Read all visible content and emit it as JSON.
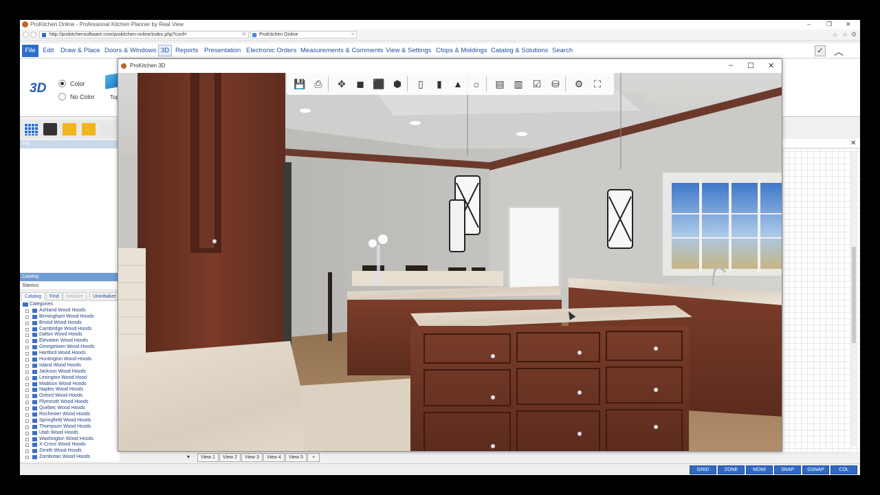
{
  "browser": {
    "title": "ProKitchen Online  -  Professional Kitchen Planner by Real View",
    "url": "http://prokitchensoftware.com/prokitchen-online/index.php?conf=",
    "tab_title": "ProKitchen Online"
  },
  "menu": {
    "file": "File",
    "items": [
      "Edit",
      "Draw & Place",
      "Doors & Windows",
      "3D",
      "Reports",
      "Presentation",
      "Electronic Orders",
      "Measurements & Comments",
      "View & Settings",
      "Ctops & Moldings",
      "Catalog & Solutions",
      "Search"
    ]
  },
  "ribbon": {
    "logo": "3D",
    "color_label": "Color",
    "nocolor_label": "No Color",
    "top_view_label": "Top View",
    "color_selected": true
  },
  "info_panel": {
    "title": "Info"
  },
  "catalog": {
    "title": "Catalog",
    "subtitle": "Stanisci",
    "tabs": [
      "Catalog",
      "Find",
      "Initialize",
      "Uninitialize"
    ],
    "root": "Categories",
    "items": [
      "Ashland Wood Hoods",
      "Birmingham Wood Hoods",
      "Bristol Wood Hoods",
      "Cambridge Wood Hoods",
      "Dalton Wood Hoods",
      "Elevation Wood Hoods",
      "Georgetown Wood Hoods",
      "Hartford Wood Hoods",
      "Huntington Wood Hoods",
      "Island Wood Hoods",
      "Jackson Wood Hoods",
      "Lexington Wood Hood",
      "Madison Wood Hoods",
      "Naples Wood Hoods",
      "Oxford Wood Hoods",
      "Plymouth Wood Hoods",
      "Quebec Wood Hoods",
      "Rochester Wood Hoods",
      "Springfield Wood Hoods",
      "Thompson Wood Hoods",
      "Utah Wood Hoods",
      "Washington Wood Hoods",
      "X-Cross Wood Hoods",
      "Zenith Wood Hoods",
      "Zombrean Wood Hoods"
    ]
  },
  "window3d": {
    "title": "ProKitchen 3D",
    "toolbar_icons": [
      "save-icon",
      "print-icon",
      "move-icon",
      "cube-solid-icon",
      "cube-shaded-icon",
      "cube-wire-icon",
      "wall-icon",
      "door-icon",
      "lamp-icon",
      "sun-icon",
      "cabinet-icon",
      "cabinet-open-icon",
      "check-icon",
      "cylinder-icon",
      "gear-icon",
      "fullscreen-icon"
    ]
  },
  "view_tabs": [
    "View 1",
    "View 2",
    "View 3",
    "View 4",
    "View 5",
    "+"
  ],
  "status_buttons": [
    "GRID",
    "ZONE",
    "MDIM",
    "SNAP",
    "GSNAP",
    "COL"
  ]
}
